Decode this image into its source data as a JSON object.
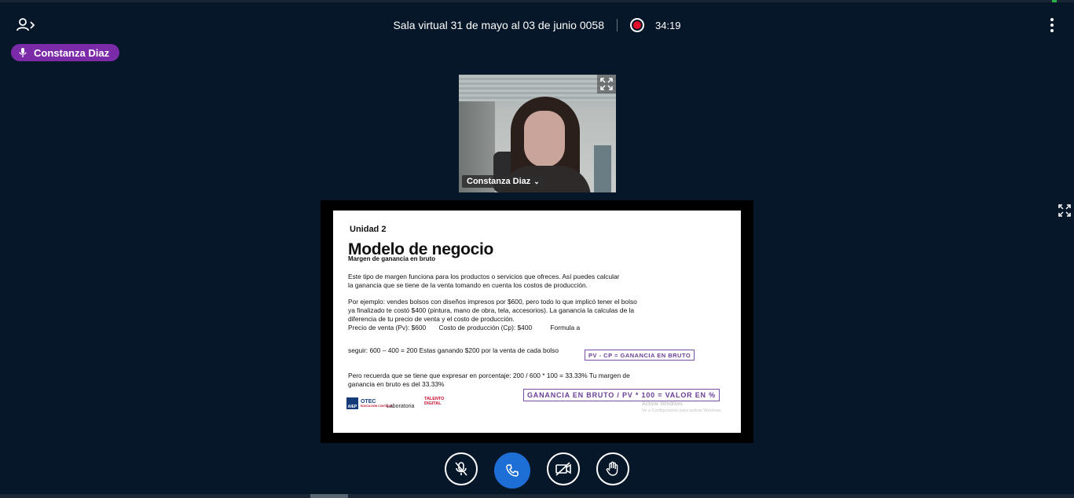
{
  "header": {
    "meeting_title": "Sala virtual 31 de mayo al 03 de junio 0058",
    "timer": "34:19",
    "users_icon": "users-toggle-icon",
    "record_icon": "recording-icon",
    "options_icon": "kebab-menu-icon"
  },
  "speaker": {
    "name": "Constanza Diaz",
    "icon": "microphone-icon"
  },
  "webcam": {
    "name": "Constanza Diaz"
  },
  "slide": {
    "unit": "Unidad 2",
    "title": "Modelo de negocio",
    "subtitle": "Margen de ganancia en bruto",
    "p1_l1": "Este tipo de margen funciona para los productos o servicios que ofreces. Así puedes calcular",
    "p1_l2": "la  ganancia que se tiene de la venta tomando en cuenta los costos de producción.",
    "p2_l1": "Por ejemplo: vendes bolsos con diseños impresos por $600, pero todo lo que implicó tener el bolso",
    "p2_l2": "ya  finalizado te costó $400 (pintura, mano de obra, tela, accesorios). La ganancia la calculas de la",
    "p2_l3": "diferencia de tu precio de venta y el costo de producción.",
    "p2_l4": "Precio de venta (Pv): $600       Costo de producción (Cp): $400          Formula a",
    "p3": "seguir:  600 – 400 = 200 Estas ganando $200 por la venta de cada bolso",
    "formula1": "PV - CP  = GANANCIA EN BRUTO",
    "p4_l1": "Pero recuerda que se tiene que expresar en porcentaje: 200 / 600 * 100 = 33.33% Tu margen de",
    "p4_l2": "ganancia en bruto es del 33.33%",
    "formula2": "GANANCIA EN BRUTO / PV * 100 = VALOR EN %",
    "watermark_l1": "Activar Windows",
    "watermark_l2": "Ve a Configuración para activar Windows.",
    "logo1_badge": "AIEP",
    "logo1_name": "OTEC",
    "logo1_tag": "EDUCACIÓN CONTINUA",
    "logo2": "Laboratoria",
    "logo3_l1": "TALENTO",
    "logo3_l2": "DIGITAL"
  },
  "controls": [
    {
      "name": "mute-mic-button",
      "icon": "microphone-off-icon"
    },
    {
      "name": "leave-audio-button",
      "icon": "phone-icon"
    },
    {
      "name": "camera-toggle-button",
      "icon": "camera-off-icon"
    },
    {
      "name": "raise-hand-button",
      "icon": "hand-icon"
    }
  ],
  "colors": {
    "background": "#06172a",
    "speaker_chip": "#7b2aa8",
    "call_button": "#1d6fd6",
    "record": "#e0102a",
    "formula_border": "#7b4fa3"
  }
}
